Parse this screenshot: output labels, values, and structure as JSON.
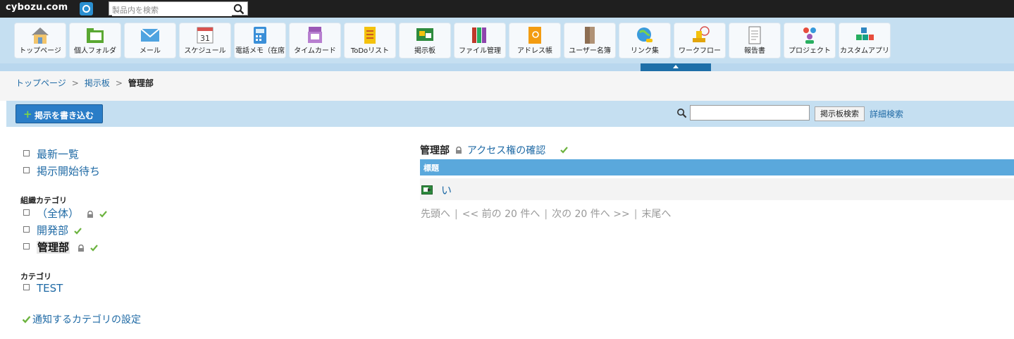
{
  "header": {
    "logo_text": "cybozu.com",
    "search_placeholder": "製品内を検索"
  },
  "apps": [
    {
      "label": "トップページ",
      "icon": "home-icon"
    },
    {
      "label": "個人フォルダ",
      "icon": "folder-icon"
    },
    {
      "label": "メール",
      "icon": "mail-icon"
    },
    {
      "label": "スケジュール",
      "icon": "calendar-icon",
      "calendar_number": "31"
    },
    {
      "label": "電話メモ（在席",
      "icon": "phone-memo-icon"
    },
    {
      "label": "タイムカード",
      "icon": "timecard-icon"
    },
    {
      "label": "ToDoリスト",
      "icon": "todo-icon"
    },
    {
      "label": "掲示板",
      "icon": "bulletin-board-icon"
    },
    {
      "label": "ファイル管理",
      "icon": "file-binder-icon"
    },
    {
      "label": "アドレス帳",
      "icon": "address-book-icon"
    },
    {
      "label": "ユーザー名簿",
      "icon": "user-directory-icon"
    },
    {
      "label": "リンク集",
      "icon": "link-globe-icon"
    },
    {
      "label": "ワークフロー",
      "icon": "workflow-stamp-icon"
    },
    {
      "label": "報告書",
      "icon": "report-icon"
    },
    {
      "label": "プロジェクト",
      "icon": "project-people-icon"
    },
    {
      "label": "カスタムアプリ",
      "icon": "custom-app-blocks-icon"
    }
  ],
  "breadcrumb": {
    "items": [
      "トップページ",
      "掲示板"
    ],
    "current": "管理部"
  },
  "toolbar": {
    "write_button": "掲示を書き込む",
    "search_button": "掲示板検索",
    "advanced_search": "詳細検索"
  },
  "sidebar": {
    "top_items": [
      "最新一覧",
      "掲示開始待ち"
    ],
    "org_title": "組織カテゴリ",
    "org_items": [
      "（全体）",
      "開発部",
      "管理部"
    ],
    "cat_title": "カテゴリ",
    "cat_items": [
      "TEST"
    ],
    "notify_link": "通知するカテゴリの設定"
  },
  "main": {
    "title": "管理部",
    "access_link": "アクセス権の確認",
    "column_header": "標題",
    "rows": [
      "い"
    ],
    "pager": {
      "first": "先頭へ",
      "prev": "<< 前の 20 件へ",
      "next": "次の 20 件へ >>",
      "last": "末尾へ"
    }
  },
  "colors": {
    "accent": "#2a7dc7",
    "link": "#1f6aa5",
    "header_bg": "#1f1f1f",
    "appbar_bg": "#c5dff1",
    "table_header": "#5aa8dc",
    "check": "#6cb33f"
  }
}
